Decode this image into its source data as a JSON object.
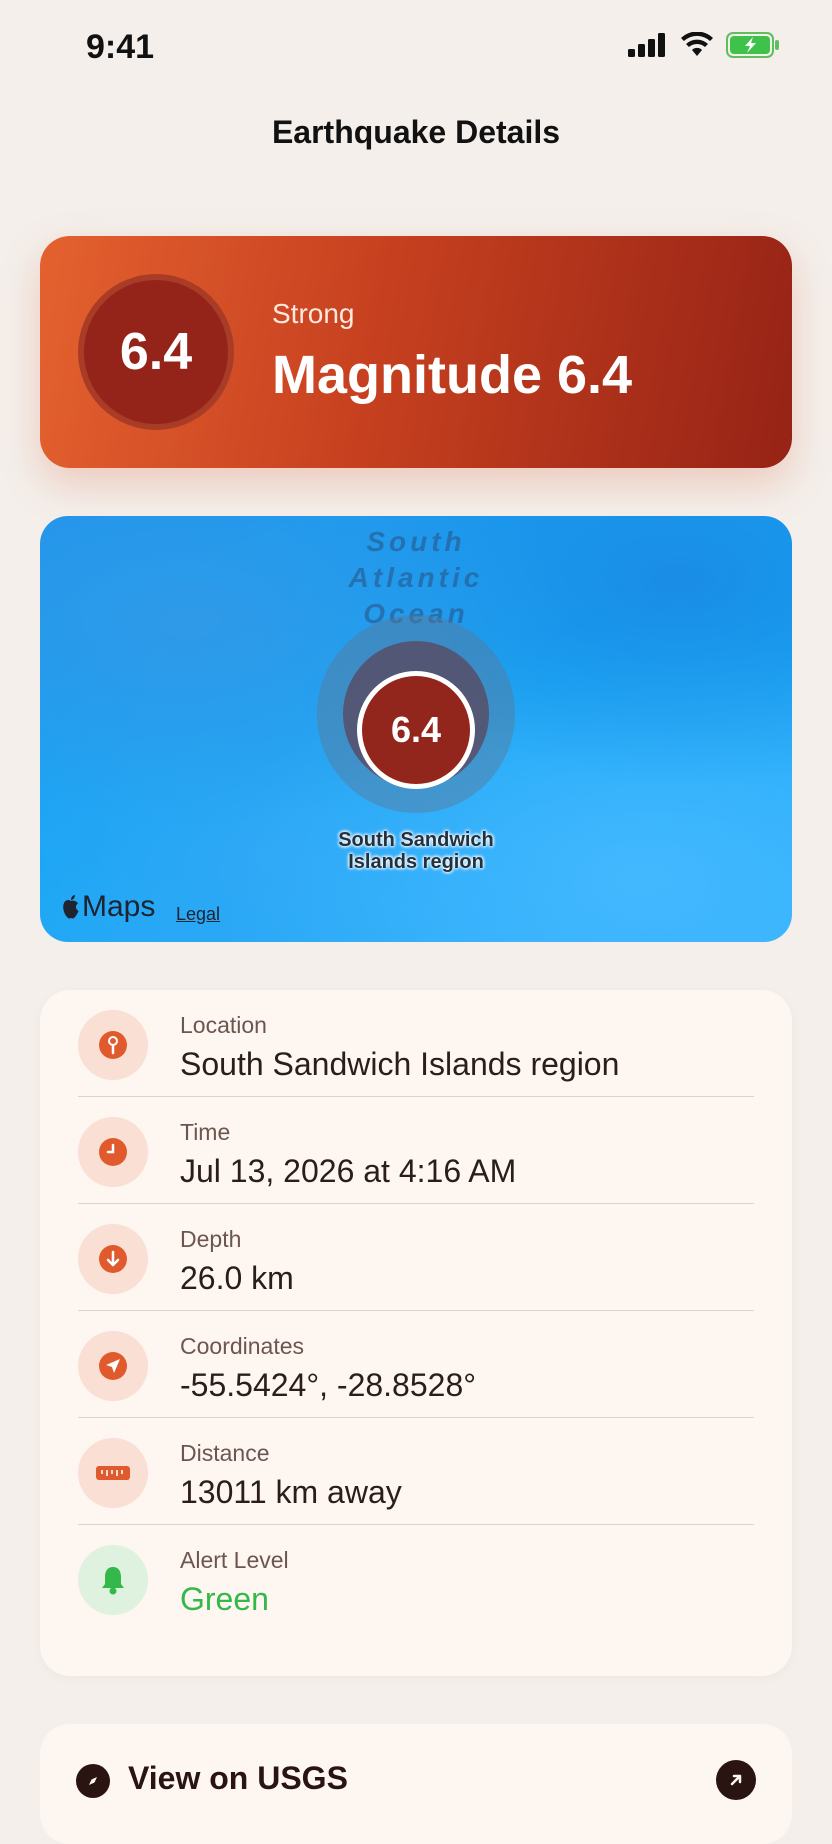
{
  "status": {
    "time": "9:41"
  },
  "nav": {
    "title": "Earthquake Details"
  },
  "magnitude": {
    "value": "6.4",
    "intensity": "Strong",
    "title": "Magnitude 6.4"
  },
  "map": {
    "ocean_label": "South Atlantic Ocean",
    "pin_value": "6.4",
    "pin_caption": "South Sandwich Islands region",
    "logo_text": "Maps",
    "legal": "Legal"
  },
  "details": [
    {
      "label": "Location",
      "value": "South Sandwich Islands region",
      "icon": "location-pin-icon"
    },
    {
      "label": "Time",
      "value": "Jul 13, 2026 at 4:16 AM",
      "icon": "clock-icon"
    },
    {
      "label": "Depth",
      "value": "26.0 km",
      "icon": "arrow-down-icon"
    },
    {
      "label": "Coordinates",
      "value": "-55.5424°, -28.8528°",
      "icon": "location-arrow-icon"
    },
    {
      "label": "Distance",
      "value": "13011 km away",
      "icon": "ruler-icon"
    },
    {
      "label": "Alert Level",
      "value": "Green",
      "icon": "bell-icon"
    }
  ],
  "usgs": {
    "label": "View on USGS"
  },
  "colors": {
    "accent": "#e4612f",
    "deep_red": "#94241a",
    "alert_green": "#34b84a"
  }
}
